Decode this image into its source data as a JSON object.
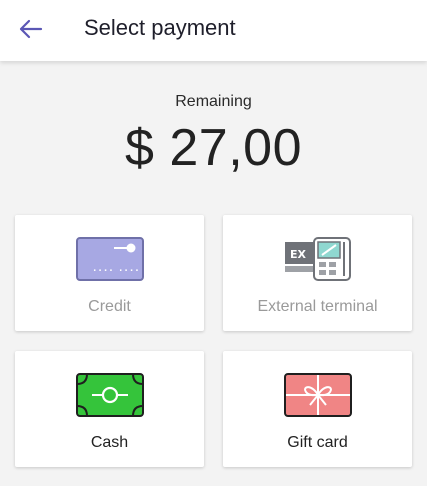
{
  "header": {
    "title": "Select payment",
    "back_icon": "arrow-left-icon",
    "accent_color": "#5b57b5"
  },
  "summary": {
    "label": "Remaining",
    "amount": "$ 27,00"
  },
  "payment_methods": [
    {
      "label": "Credit",
      "icon": "credit-card-icon",
      "enabled": false
    },
    {
      "label": "External terminal",
      "icon": "external-terminal-icon",
      "enabled": false
    },
    {
      "label": "Cash",
      "icon": "cash-icon",
      "enabled": true
    },
    {
      "label": "Gift card",
      "icon": "gift-card-icon",
      "enabled": true
    }
  ],
  "icon_text": {
    "credit_digits_a": "....",
    "credit_digits_b": "....",
    "terminal_badge": "EX"
  }
}
